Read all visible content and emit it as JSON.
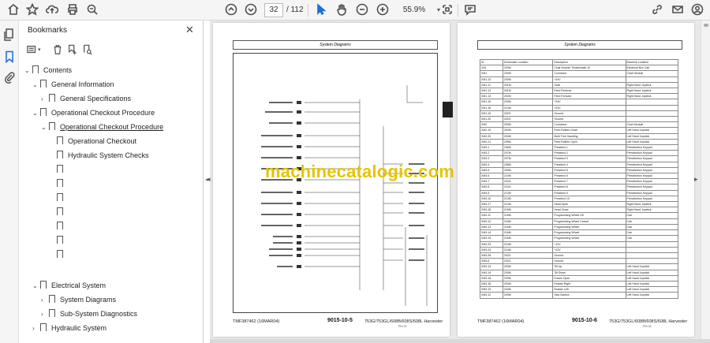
{
  "toolbar": {
    "current_page": "32",
    "total_pages": "/ 112",
    "zoom": "55.9%"
  },
  "bookmarks": {
    "title": "Bookmarks",
    "items": [
      {
        "label": "Contents",
        "arrow": "v"
      },
      {
        "label": "General Information",
        "arrow": "v"
      },
      {
        "label": "General Specifications",
        "arrow": ">"
      },
      {
        "label": "Operational Checkout Procedure",
        "arrow": "v"
      },
      {
        "label": "Operational Checkout Procedure",
        "arrow": "v"
      },
      {
        "label": "Operational Checkout",
        "arrow": ""
      },
      {
        "label": "Hydraulic System Checks",
        "arrow": ""
      },
      {
        "label": "",
        "arrow": ""
      },
      {
        "label": "",
        "arrow": ""
      },
      {
        "label": "",
        "arrow": ""
      },
      {
        "label": "",
        "arrow": ""
      },
      {
        "label": "",
        "arrow": ""
      },
      {
        "label": "",
        "arrow": ""
      },
      {
        "label": "",
        "arrow": ""
      },
      {
        "label": "Electrical System",
        "arrow": "v"
      },
      {
        "label": "System Diagrams",
        "arrow": ">"
      },
      {
        "label": "Sub-System Diagnostics",
        "arrow": ">"
      },
      {
        "label": "Hydraulic System",
        "arrow": ">"
      }
    ]
  },
  "watermark": "machinecatalogic.com",
  "page_left": {
    "header": "System Diagrams",
    "footer_left": "TMF387462 (16MAR04)",
    "footer_center": "9015-10-5",
    "footer_right": "753G/753GL/608B/608S/608L Harvester",
    "footer_small": "PN=31"
  },
  "page_right": {
    "header": "System Diagrams",
    "footer_left": "TMF387462 (16MAR04)",
    "footer_center": "9015-10-6",
    "footer_right": "753G/753GL/608B/608S/608L Harvester",
    "footer_small": "PN=32",
    "table_header": [
      "ID",
      "Schematic Location",
      "Description",
      "Machine Location"
    ],
    "table_rows": [
      [
        "XA1",
        "200M",
        "Chair Module Timbermatic 10",
        "Electrical Box Cab"
      ],
      [
        "XM1",
        "200M",
        "Connector",
        "Chair Module"
      ],
      [
        "XM1-10",
        "200M",
        "+24V",
        ""
      ],
      [
        "XM1-11",
        "201M",
        "Grab",
        "Right Hand Joystick"
      ],
      [
        "XM1-12",
        "201M",
        "Feed Reverse",
        "Right Hand Joystick"
      ],
      [
        "XM1-13",
        "202M",
        "Feed Forward",
        "Right Hand Joystick"
      ],
      [
        "XM1-16",
        "203M",
        "+24V",
        ""
      ],
      [
        "XM1-18",
        "214M",
        "+24V",
        ""
      ],
      [
        "XM1-19",
        "202G",
        "Ground",
        ""
      ],
      [
        "XM1-20",
        "202G",
        "Ground",
        ""
      ],
      [
        "XM2",
        "200M",
        "Connector",
        "Chair Module"
      ],
      [
        "XM2-19",
        "202M",
        "Feed Rollers Close",
        "Left Hand Joystick"
      ],
      [
        "XM2-20",
        "204M",
        "Multi Tree Handling",
        "Left Hand Joystick"
      ],
      [
        "XM2-21",
        "205M",
        "Feed Rollers Open",
        "Left Hand Joystick"
      ],
      [
        "XM3-1",
        "206M",
        "Preselect 1",
        "Preselection Keypad"
      ],
      [
        "XM3-2",
        "207M",
        "Preselect 2",
        "Preselection Keypad"
      ],
      [
        "XM3-3",
        "207M",
        "Preselect 3",
        "Preselection Keypad"
      ],
      [
        "XM3-4",
        "208M",
        "Preselect 4",
        "Preselection Keypad"
      ],
      [
        "XM3-5",
        "209M",
        "Preselect 5",
        "Preselection Keypad"
      ],
      [
        "XM3-6",
        "210M",
        "Preselect 6",
        "Preselection Keypad"
      ],
      [
        "XM3-7",
        "211M",
        "Preselect 7",
        "Preselection Keypad"
      ],
      [
        "XM3-8",
        "211M",
        "Preselect 8",
        "Preselection Keypad"
      ],
      [
        "XM3-9",
        "212M",
        "Preselect 9",
        "Preselection Keypad"
      ],
      [
        "XM3-10",
        "213M",
        "Preselect 10",
        "Preselection Keypad"
      ],
      [
        "XM3-17",
        "214M",
        "Head Open",
        "Right Hand Joystick"
      ],
      [
        "XM3-18",
        "215M",
        "Head Close",
        "Right Hand Joystick"
      ],
      [
        "XM3-11",
        "216M",
        "Programming Wheel OK",
        "Cab"
      ],
      [
        "XM3-12",
        "216M",
        "Programming Wheel Cancel",
        "Cab"
      ],
      [
        "XM3-13",
        "216M",
        "Programming Wheel",
        "Cab"
      ],
      [
        "XM3-14",
        "216M",
        "Programming Wheel",
        "Cab"
      ],
      [
        "XM3-15",
        "216M",
        "Programming Wheel",
        "Cab"
      ],
      [
        "XM3-23",
        "214M",
        "+12V",
        ""
      ],
      [
        "XM3-24",
        "214M",
        "+12V",
        ""
      ],
      [
        "XM3-25",
        "202G",
        "Ground",
        ""
      ],
      [
        "XM3-6",
        "202G",
        "Ground",
        ""
      ],
      [
        "XM3-13",
        "203M",
        "Tilt Up",
        "Left Hand Joystick"
      ],
      [
        "XM3-14",
        "203M",
        "Tilt Down",
        "Left Hand Joystick"
      ],
      [
        "XM3-16",
        "203M",
        "Knives Open",
        "Left Hand Joystick"
      ],
      [
        "XM3-18",
        "204M",
        "Rotator Right",
        "Left Hand Joystick"
      ],
      [
        "XM3-19",
        "204M",
        "Rotator Left",
        "Left Hand Joystick"
      ],
      [
        "XM3-12",
        "203M",
        "Saw Saction",
        "Left Hand Joystick"
      ]
    ]
  }
}
